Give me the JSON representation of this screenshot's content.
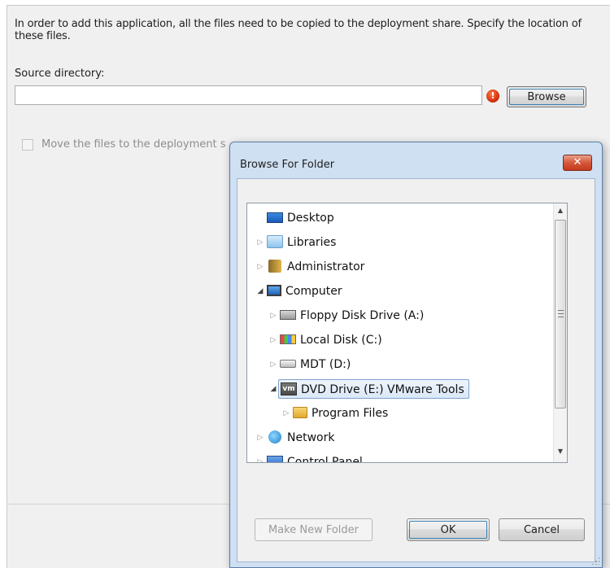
{
  "wizard": {
    "intro_text": "In order to add this application, all the files need to be copied to the deployment share.  Specify the location of these files.",
    "source_label": "Source directory:",
    "source_value": "",
    "error_symbol": "!",
    "browse_label": "Browse",
    "move_label": "Move the files to the deployment s",
    "move_checked": false
  },
  "dialog": {
    "title": "Browse For Folder",
    "close_symbol": "✕",
    "tree": [
      {
        "label": "Desktop",
        "icon": "desktop-icon",
        "expander": ""
      },
      {
        "label": "Libraries",
        "icon": "libraries-icon",
        "expander": "▷"
      },
      {
        "label": "Administrator",
        "icon": "user-folder-icon",
        "expander": "▷"
      },
      {
        "label": "Computer",
        "icon": "computer-icon",
        "expander": "◢"
      },
      {
        "label": "Floppy Disk Drive (A:)",
        "icon": "floppy-drive-icon",
        "expander": "▷"
      },
      {
        "label": "Local Disk (C:)",
        "icon": "local-disk-icon",
        "expander": "▷"
      },
      {
        "label": "MDT (D:)",
        "icon": "drive-icon",
        "expander": "▷"
      },
      {
        "label": "DVD Drive (E:) VMware Tools",
        "icon": "dvd-drive-icon",
        "expander": "◢",
        "icon_text": "vm",
        "selected": true
      },
      {
        "label": "Program Files",
        "icon": "folder-icon",
        "expander": "▷"
      },
      {
        "label": "Network",
        "icon": "network-icon",
        "expander": "▷"
      },
      {
        "label": "Control Panel",
        "icon": "control-panel-icon",
        "expander": "▷"
      }
    ],
    "scroll_up": "▲",
    "scroll_down": "▼",
    "make_new_folder_label": "Make New Folder",
    "ok_label": "OK",
    "cancel_label": "Cancel"
  }
}
